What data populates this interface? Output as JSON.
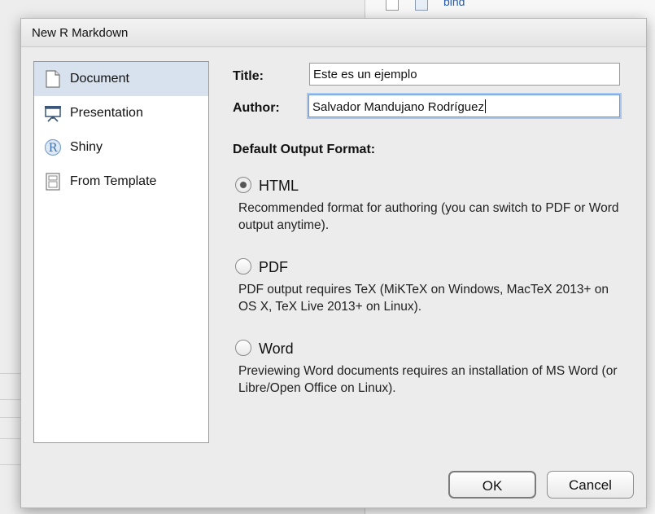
{
  "background": {
    "file_row_text": "bind"
  },
  "dialog": {
    "title": "New R Markdown",
    "sidebar": {
      "items": [
        {
          "label": "Document",
          "icon": "document-icon",
          "selected": true
        },
        {
          "label": "Presentation",
          "icon": "presentation-icon",
          "selected": false
        },
        {
          "label": "Shiny",
          "icon": "shiny-r-icon",
          "selected": false
        },
        {
          "label": "From Template",
          "icon": "template-icon",
          "selected": false
        }
      ]
    },
    "form": {
      "title_label": "Title:",
      "title_value": "Este es un ejemplo",
      "author_label": "Author:",
      "author_value": "Salvador Mandujano Rodríguez",
      "format_heading": "Default Output Format:",
      "options": [
        {
          "label": "HTML",
          "checked": true,
          "description": "Recommended format for authoring (you can switch to PDF or Word output anytime)."
        },
        {
          "label": "PDF",
          "checked": false,
          "description": "PDF output requires TeX (MiKTeX on Windows, MacTeX 2013+ on OS X, TeX Live 2013+ on Linux)."
        },
        {
          "label": "Word",
          "checked": false,
          "description": "Previewing Word documents requires an installation of MS Word (or Libre/Open Office on Linux)."
        }
      ]
    },
    "buttons": {
      "ok": "OK",
      "cancel": "Cancel"
    }
  },
  "colors": {
    "selected_item": "#d7e2ee",
    "focus_ring": "#a9c6ee",
    "link_text": "#2a5ca8"
  }
}
